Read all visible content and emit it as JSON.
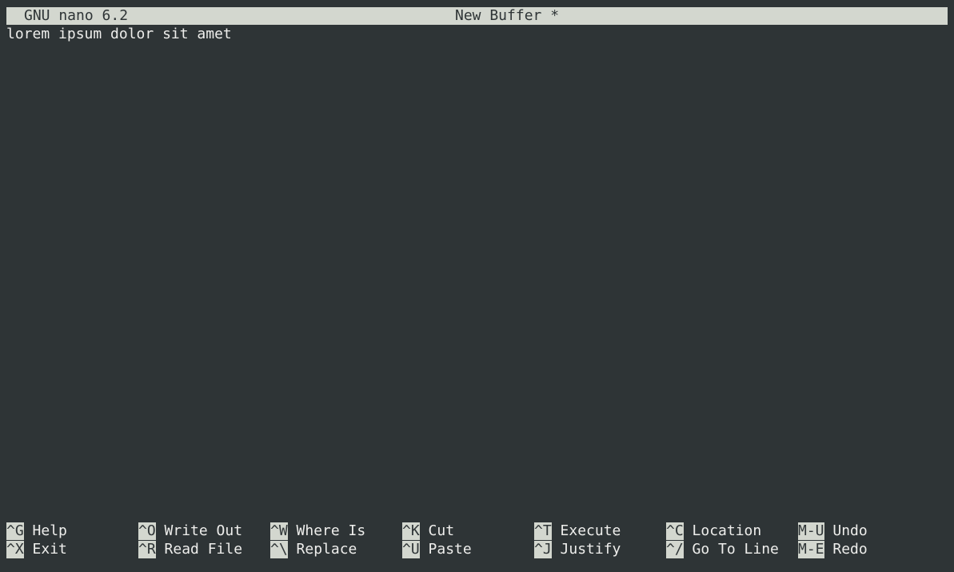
{
  "title_bar": {
    "app_version": "GNU nano 6.2",
    "buffer_title": "New Buffer *"
  },
  "editor": {
    "lines": [
      "lorem ipsum dolor sit amet"
    ]
  },
  "shortcuts": {
    "row1": [
      {
        "key": "^G",
        "label": " Help"
      },
      {
        "key": "^O",
        "label": " Write Out"
      },
      {
        "key": "^W",
        "label": " Where Is"
      },
      {
        "key": "^K",
        "label": " Cut"
      },
      {
        "key": "^T",
        "label": " Execute"
      },
      {
        "key": "^C",
        "label": " Location"
      },
      {
        "key": "M-U",
        "label": " Undo"
      }
    ],
    "row2": [
      {
        "key": "^X",
        "label": " Exit"
      },
      {
        "key": "^R",
        "label": " Read File"
      },
      {
        "key": "^\\",
        "label": " Replace"
      },
      {
        "key": "^U",
        "label": " Paste"
      },
      {
        "key": "^J",
        "label": " Justify"
      },
      {
        "key": "^/",
        "label": " Go To Line"
      },
      {
        "key": "M-E",
        "label": " Redo"
      }
    ]
  },
  "colors": {
    "background": "#2e3436",
    "bar": "#d3d7cf",
    "text": "#eeeeec"
  }
}
